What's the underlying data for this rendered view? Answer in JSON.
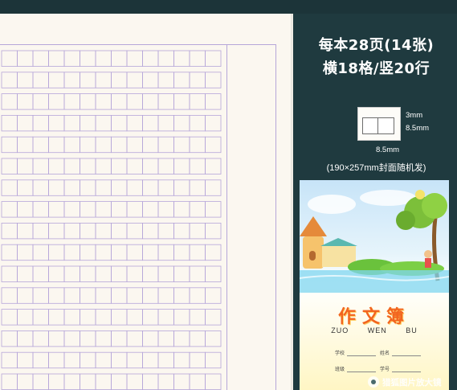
{
  "paper": {
    "grid_columns": 14,
    "grid_rows_visible": 16,
    "line_color": "#b6a6d9",
    "background": "#fbf7f0"
  },
  "spec": {
    "pages_line": "每本28页(14张)",
    "grid_line": "横18格/竖20行",
    "dimension_height": "3mm",
    "dimension_cell": "8.5mm",
    "dimension_width": "8.5mm",
    "size_note": "(190×257mm封面随机发)"
  },
  "cover": {
    "title": "作文簿",
    "pinyin": [
      "ZUO",
      "WEN",
      "BU"
    ],
    "field_school": "学校",
    "field_name": "姓名",
    "field_class": "班级",
    "field_number": "学号",
    "accent_color": "#f2651f"
  },
  "watermark": {
    "text": "猎狐图片放大镜"
  },
  "colors": {
    "panel_bg": "#1f3a3f",
    "panel_text": "#ffffff"
  }
}
